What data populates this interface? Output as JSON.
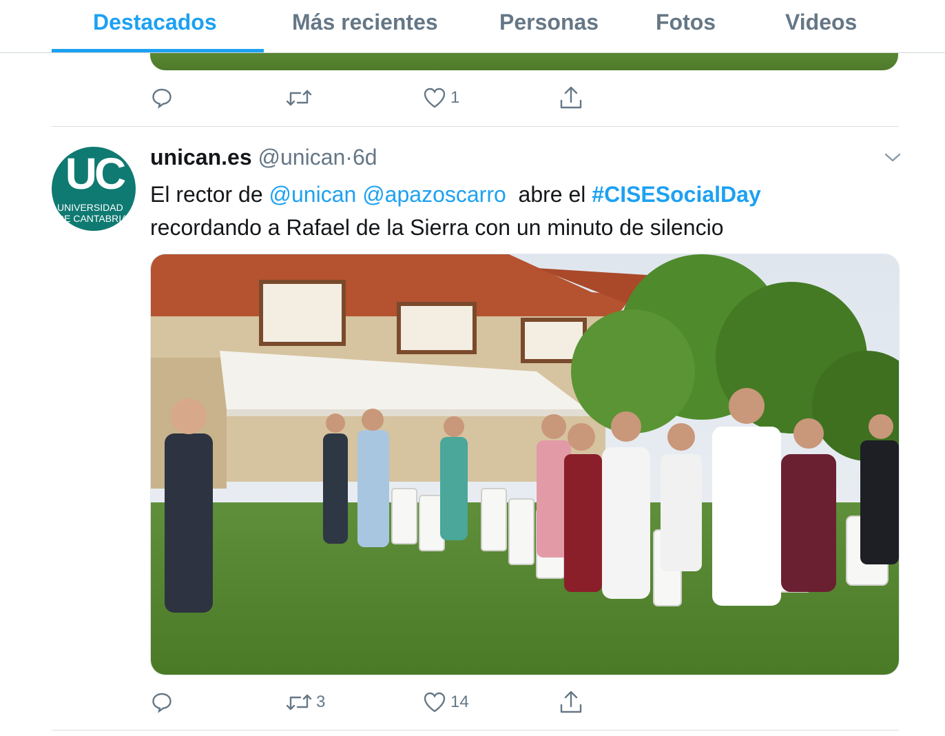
{
  "tabs": [
    {
      "label": "Destacados",
      "active": true
    },
    {
      "label": "Más recientes",
      "active": false
    },
    {
      "label": "Personas",
      "active": false
    },
    {
      "label": "Fotos",
      "active": false
    },
    {
      "label": "Videos",
      "active": false
    }
  ],
  "prev_tweet": {
    "actions": {
      "reply": "",
      "retweet": "",
      "like": "1"
    }
  },
  "tweet": {
    "avatar": {
      "monogram": "UC",
      "line1": "UNIVERSIDAD",
      "line2": "DE CANTABRIA"
    },
    "name": "unican.es",
    "handle": "@unican",
    "separator": "·",
    "time": "6d",
    "text": {
      "prefix": "El rector de ",
      "mention1": "@unican",
      "mention2": "@apazoscarro",
      "middle": "  abre el ",
      "hashtag": "#CISESocialDay",
      "suffix": "recordando a Rafael de la Sierra con un minuto de silencio"
    },
    "actions": {
      "reply": "",
      "retweet": "3",
      "like": "14"
    }
  },
  "colors": {
    "accent": "#1da1f2",
    "muted": "#657786",
    "text": "#14171a",
    "avatar_bg": "#0f7a72"
  }
}
